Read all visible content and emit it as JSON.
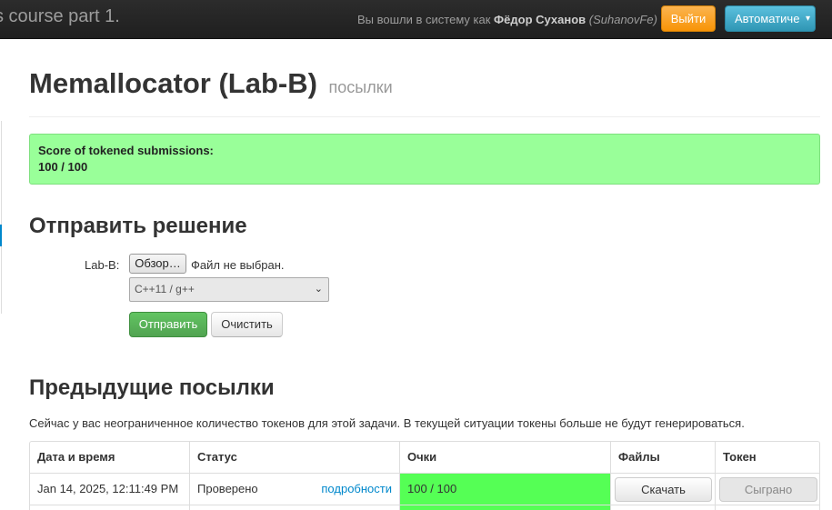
{
  "navbar": {
    "brand": "s course part 1.",
    "logged_prefix": "Вы вошли в систему как",
    "user_name": "Фёдор Суханов",
    "user_login": "(SuhanovFe)",
    "logout_label": "Выйти",
    "language_label": "Автоматиче",
    "logout_color": "#f89406",
    "language_color": "#2f96b4"
  },
  "header": {
    "title": "Memallocator (Lab-B)",
    "subtitle": "посылки"
  },
  "score_alert": {
    "title": "Score of tokened submissions:",
    "value": "100 / 100",
    "color": "#99ff99"
  },
  "submit": {
    "heading": "Отправить решение",
    "file_label": "Lab-B:",
    "browse_label": "Обзор…",
    "file_status": "Файл не выбран.",
    "language_selected": "C++11 / g++",
    "send_label": "Отправить",
    "clear_label": "Очистить"
  },
  "previous": {
    "heading": "Предыдущие посылки",
    "info": "Сейчас у вас неограниченное количество токенов для этой задачи. В текущей ситуации токены больше не будут генерироваться.",
    "columns": [
      "Дата и время",
      "Статус",
      "Очки",
      "Файлы",
      "Токен"
    ],
    "rows": [
      {
        "date": "Jan 14, 2025, 12:11:49 PM",
        "status": "Проверено",
        "details": "подробности",
        "score": "100 / 100",
        "download": "Скачать",
        "token": "Сыграно",
        "score_color": "#55ff55"
      }
    ]
  }
}
